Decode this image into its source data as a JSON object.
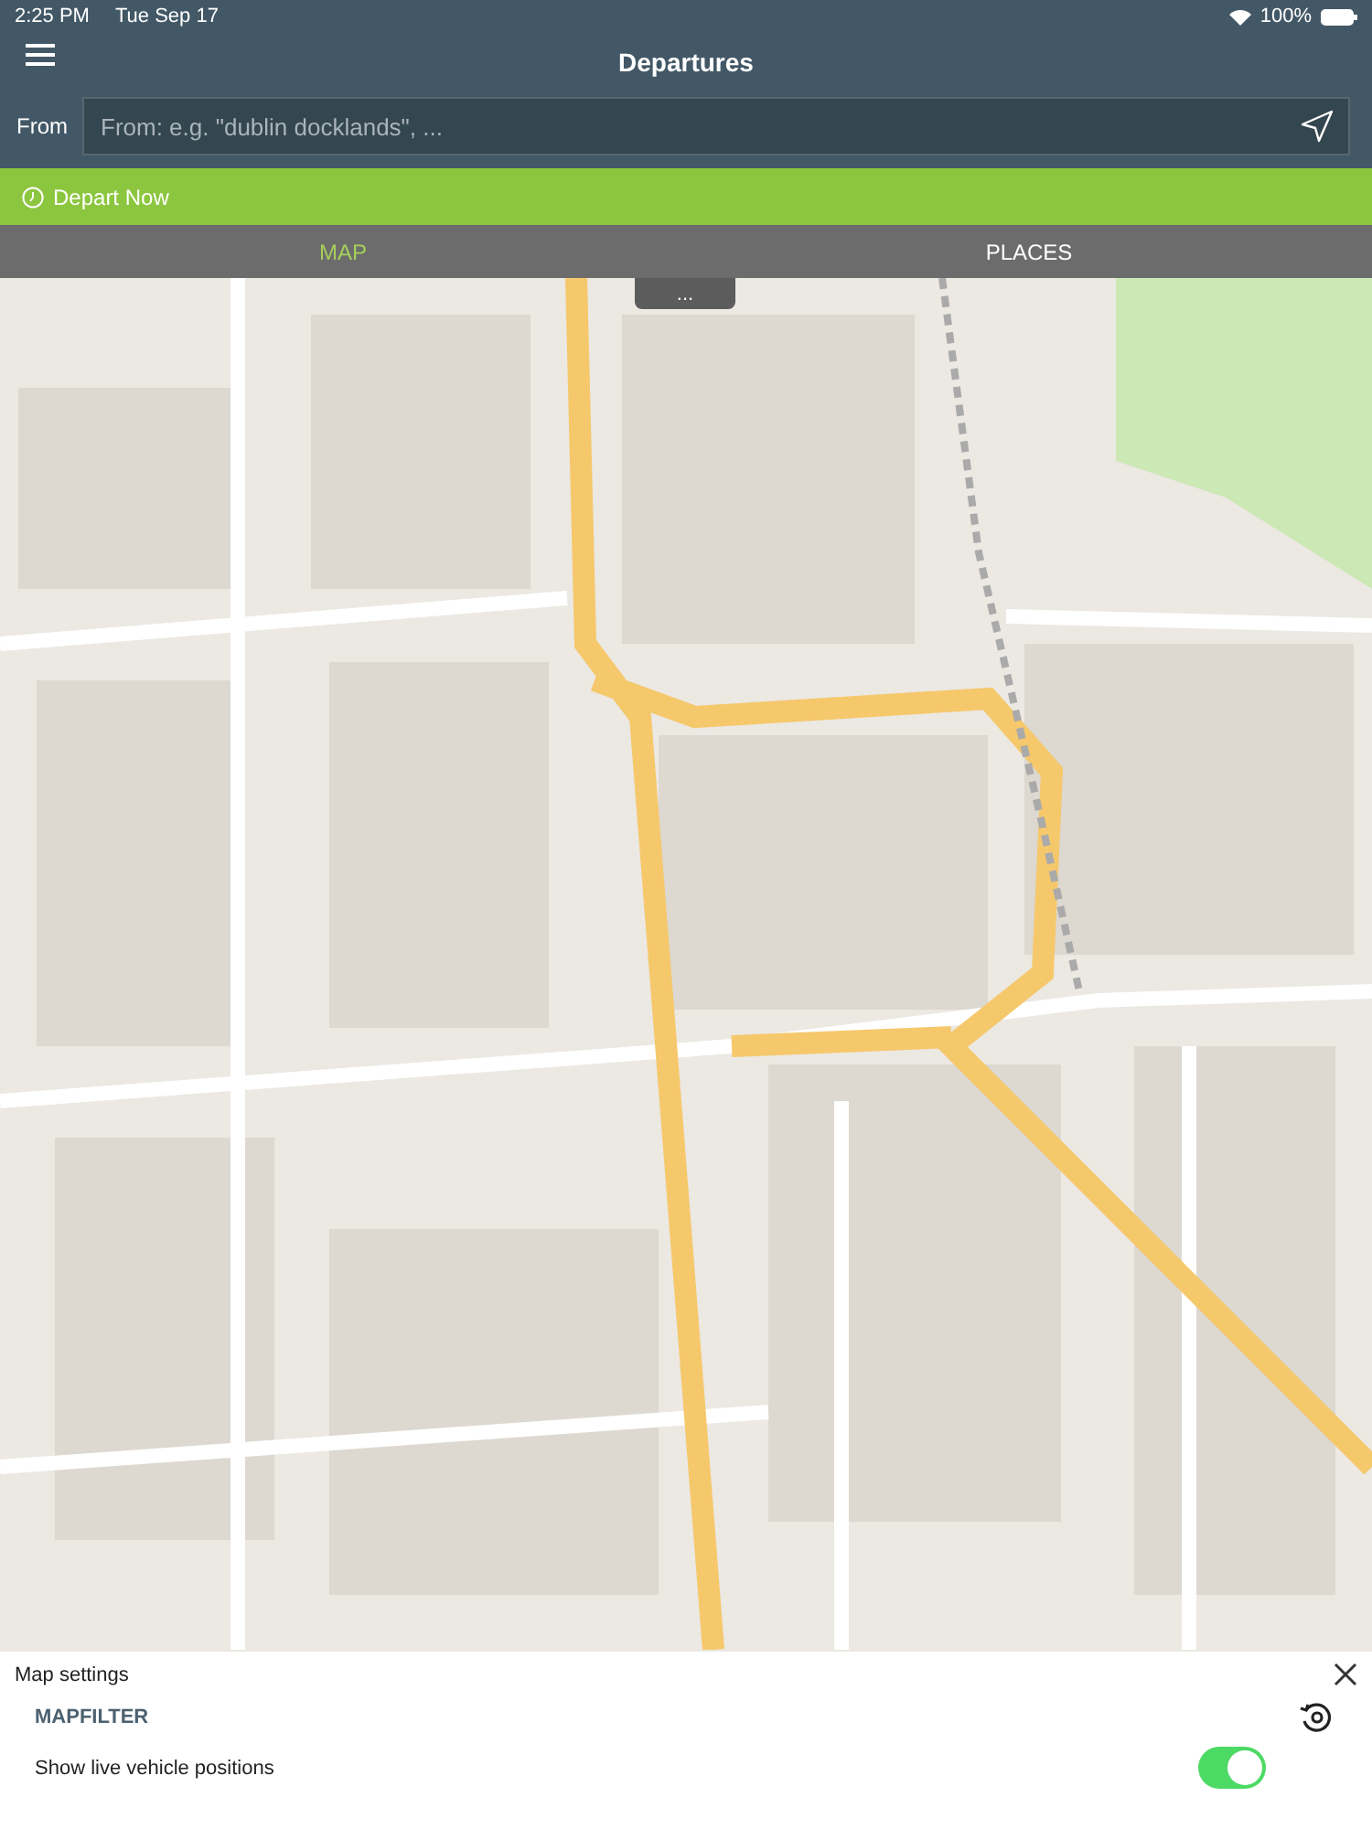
{
  "status_bar": {
    "time": "2:25 PM",
    "date": "Tue Sep 17",
    "battery": "100%"
  },
  "header": {
    "title": "Departures"
  },
  "from": {
    "label": "From",
    "placeholder": "From: e.g. \"dublin docklands\", ..."
  },
  "depart": {
    "label": "Depart Now"
  },
  "tabs": [
    {
      "label": "MAP",
      "selected": true
    },
    {
      "label": "PLACES",
      "selected": false
    }
  ],
  "map": {
    "handle": "..."
  },
  "settings": {
    "title": "Map settings",
    "section": "MAPFILTER",
    "options": [
      {
        "label": "Show live vehicle positions",
        "on": true
      }
    ]
  }
}
